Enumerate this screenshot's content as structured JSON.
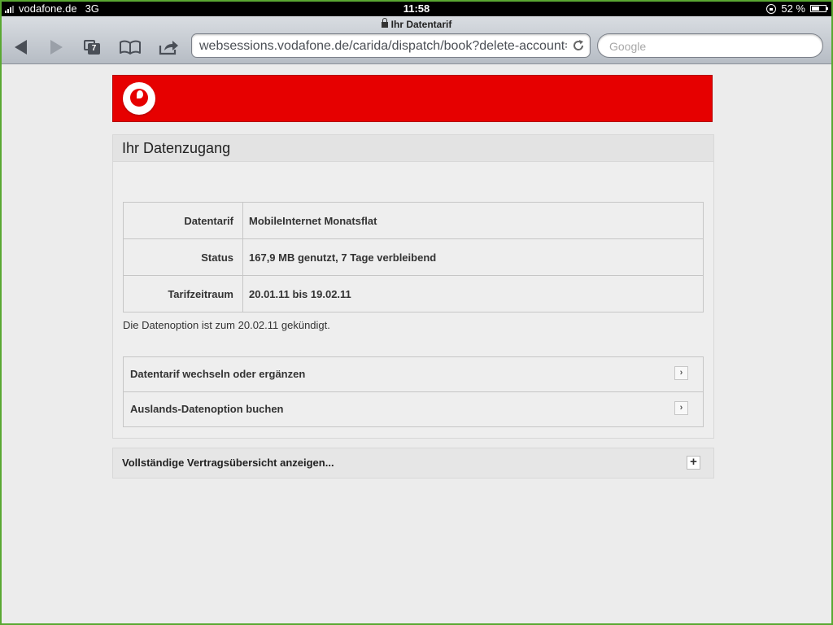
{
  "status_bar": {
    "carrier": "vodafone.de",
    "network": "3G",
    "time": "11:58",
    "battery": "52 %"
  },
  "browser": {
    "page_title": "Ihr Datentarif",
    "url": "websessions.vodafone.de/carida/dispatch/book?delete-account=1…",
    "search_placeholder": "Google",
    "tab_count": "7"
  },
  "page": {
    "brand_color": "#e60000",
    "section_title": "Ihr Datenzugang",
    "rows": [
      {
        "label": "Datentarif",
        "value": "MobileInternet Monatsflat"
      },
      {
        "label": "Status",
        "value": "167,9 MB genutzt, 7 Tage verbleibend"
      },
      {
        "label": "Tarifzeitraum",
        "value": "20.01.11 bis 19.02.11"
      }
    ],
    "notice": "Die Datenoption ist zum 20.02.11 gekündigt.",
    "links": [
      {
        "label": "Datentarif wechseln oder ergänzen",
        "chevron": "›"
      },
      {
        "label": "Auslands-Datenoption buchen",
        "chevron": "›"
      }
    ],
    "accordion": {
      "label": "Vollständige Vertragsübersicht anzeigen...",
      "toggle": "+"
    }
  }
}
